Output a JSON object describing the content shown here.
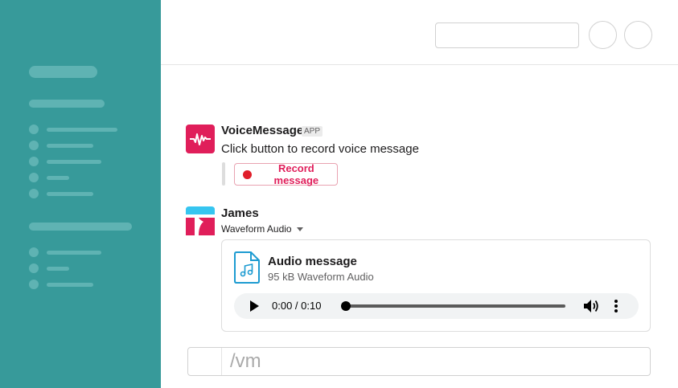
{
  "header": {
    "search": {
      "value": ""
    }
  },
  "messages": {
    "voice_bot": {
      "sender": "VoiceMessage",
      "badge": "APP",
      "text": "Click button to record voice message",
      "button_label": "Record message",
      "avatar_color": "#e01e5a"
    },
    "james": {
      "sender": "James",
      "file_label": "Waveform Audio",
      "file": {
        "title": "Audio message",
        "subtitle": "95 kB Waveform Audio",
        "time": "0:00 / 0:10",
        "progress": 0
      }
    }
  },
  "composer": {
    "value": "/vm"
  },
  "colors": {
    "sidebar": "#379a9a",
    "accent": "#e01e5a",
    "file_icon": "#1d9bd1"
  }
}
